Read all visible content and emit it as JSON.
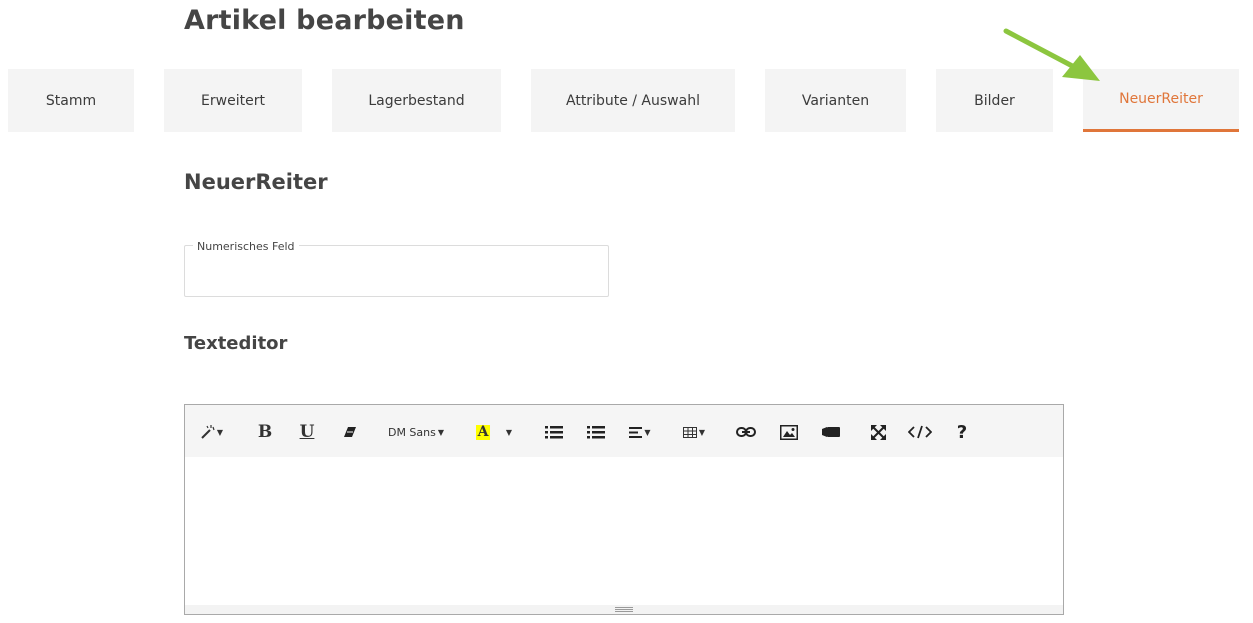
{
  "page": {
    "title": "Artikel bearbeiten"
  },
  "tabs": [
    {
      "label": "Stamm",
      "active": false
    },
    {
      "label": "Erweitert",
      "active": false
    },
    {
      "label": "Lagerbestand",
      "active": false
    },
    {
      "label": "Attribute / Auswahl",
      "active": false
    },
    {
      "label": "Varianten",
      "active": false
    },
    {
      "label": "Bilder",
      "active": false
    },
    {
      "label": "NeuerReiter",
      "active": true
    }
  ],
  "section": {
    "title": "NeuerReiter"
  },
  "numeric_field": {
    "legend": "Numerisches Feld",
    "value": ""
  },
  "editor": {
    "title": "Texteditor",
    "font_name": "DM Sans",
    "content": "",
    "toolbar": [
      "magic-icon",
      "bold-icon",
      "underline-icon",
      "eraser-icon",
      "font-name-dropdown",
      "highlight-icon",
      "color-dropdown",
      "bullet-list-icon",
      "numbered-list-icon",
      "align-icon",
      "table-icon",
      "link-icon",
      "image-icon",
      "video-icon",
      "fullscreen-icon",
      "code-view-icon",
      "help-icon"
    ]
  },
  "colors": {
    "accent": "#e0763a",
    "tab_bg": "#f4f4f4",
    "arrow": "#8cc63f",
    "highlight": "#ffff00"
  }
}
